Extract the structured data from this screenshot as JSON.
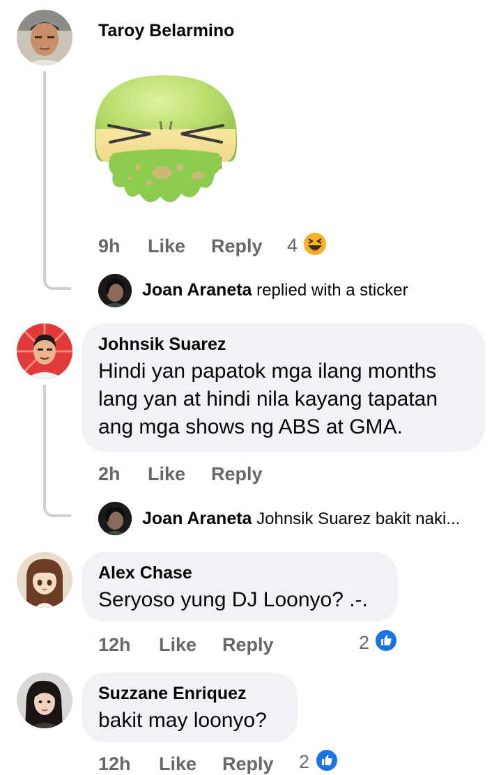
{
  "comments": [
    {
      "author": "Taroy Belarmino",
      "time": "9h",
      "like_label": "Like",
      "reply_label": "Reply",
      "reaction_count": "4",
      "reaction_icon": "haha-emoji-icon",
      "sticker": "vomit-face-sticker",
      "reply_preview": {
        "author": "Joan Araneta",
        "text": "replied with a sticker"
      }
    },
    {
      "author": "Johnsik Suarez",
      "text_lines": [
        "Hindi yan papatok mga ilang months",
        "lang yan at hindi nila kayang tapatan",
        "ang mga shows ng ABS at GMA."
      ],
      "time": "2h",
      "like_label": "Like",
      "reply_label": "Reply",
      "reply_preview": {
        "author": "Joan Araneta",
        "text": "Johnsik Suarez bakit naki..."
      }
    },
    {
      "author": "Alex Chase",
      "text": "Seryoso yung DJ Loonyo? .-.",
      "time": "12h",
      "like_label": "Like",
      "reply_label": "Reply",
      "reaction_count": "2",
      "reaction_icon": "like-thumb-icon"
    },
    {
      "author": "Suzzane Enriquez",
      "text": "bakit may loonyo?",
      "time": "12h",
      "like_label": "Like",
      "reply_label": "Reply",
      "reaction_count": "2",
      "reaction_icon": "like-thumb-icon"
    }
  ],
  "colors": {
    "bubble": "#f0f2f5",
    "meta_text": "#65676b",
    "like_blue": "#1b74e4",
    "thread_line": "#ccd0d5"
  }
}
